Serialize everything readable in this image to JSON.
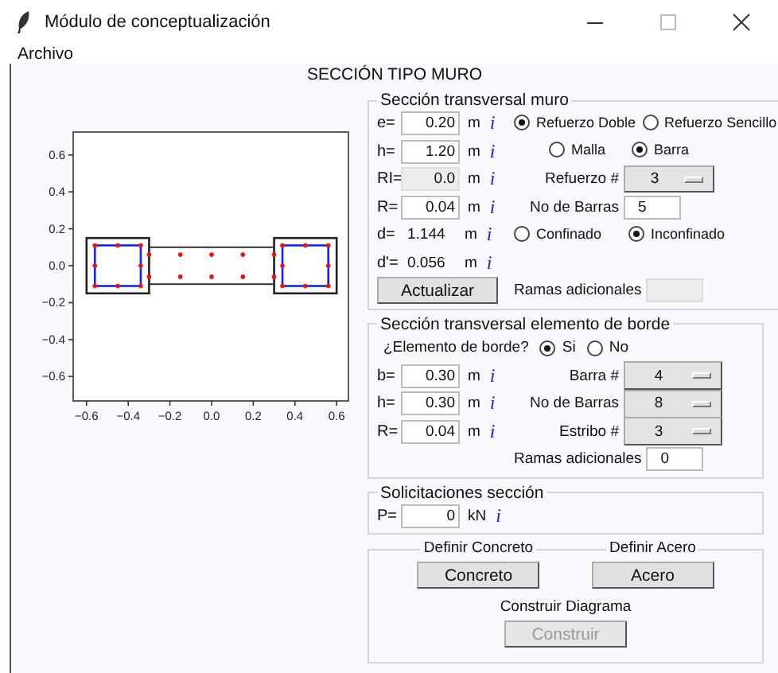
{
  "window": {
    "title": "Módulo de conceptualización"
  },
  "menu": [
    "Archivo"
  ],
  "header": "SECCIÓN TIPO MURO",
  "plot": {
    "xticks": [
      "−0.6",
      "−0.4",
      "−0.2",
      "0.0",
      "0.2",
      "0.4",
      "0.6"
    ],
    "yticks": [
      "0.6",
      "0.4",
      "0.2",
      "0.0",
      "−0.2",
      "−0.4",
      "−0.6"
    ]
  },
  "muro": {
    "legend": "Sección transversal muro",
    "params": [
      {
        "kind": "entry",
        "label": "e=",
        "value": "0.20",
        "unit": "m",
        "info": "i",
        "disabled": false
      },
      {
        "kind": "entry",
        "label": "h=",
        "value": "1.20",
        "unit": "m",
        "info": "i",
        "disabled": false
      },
      {
        "kind": "entry",
        "label": "RI=",
        "value": "0.0",
        "unit": "m",
        "info": "i",
        "disabled": true
      },
      {
        "kind": "entry",
        "label": "R=",
        "value": "0.04",
        "unit": "m",
        "info": "i",
        "disabled": false
      },
      {
        "kind": "text",
        "label": "d=",
        "value": "1.144",
        "unit": "m",
        "info": "i"
      },
      {
        "kind": "text",
        "label": "d'=",
        "value": "0.056",
        "unit": "m",
        "info": "i"
      }
    ],
    "reinforcement": [
      {
        "label": "Refuerzo Doble",
        "selected": true
      },
      {
        "label": "Refuerzo Sencillo",
        "selected": false
      }
    ],
    "layout": [
      {
        "label": "Malla",
        "selected": false
      },
      {
        "label": "Barra",
        "selected": true
      }
    ],
    "bar_size": {
      "label": "Refuerzo #",
      "value": "3"
    },
    "bar_count": {
      "label": "No de Barras",
      "value": "5"
    },
    "confinement": [
      {
        "label": "Confinado",
        "selected": false
      },
      {
        "label": "Inconfinado",
        "selected": true
      }
    ],
    "update_button": "Actualizar",
    "extra_branches": {
      "label": "Ramas adicionales",
      "disabled": true
    }
  },
  "borde": {
    "legend": "Sección transversal elemento de borde",
    "question": "¿Elemento de borde?",
    "options": [
      {
        "label": "Si",
        "selected": true
      },
      {
        "label": "No",
        "selected": false
      }
    ],
    "params": [
      {
        "kind": "entry",
        "label": "b=",
        "value": "0.30",
        "unit": "m",
        "info": "i",
        "disabled": false
      },
      {
        "kind": "entry",
        "label": "h=",
        "value": "0.30",
        "unit": "m",
        "info": "i",
        "disabled": false
      },
      {
        "kind": "entry",
        "label": "R=",
        "value": "0.04",
        "unit": "m",
        "info": "i",
        "disabled": false
      }
    ],
    "selectors": [
      {
        "label": "Barra #",
        "value": "4"
      },
      {
        "label": "No de Barras",
        "value": "8"
      },
      {
        "label": "Estribo #",
        "value": "3"
      }
    ],
    "extra_branches": {
      "label": "Ramas adicionales",
      "value": "0",
      "disabled": false
    }
  },
  "solicitaciones": {
    "legend": "Solicitaciones sección",
    "params": [
      {
        "kind": "entry",
        "label": "P=",
        "value": "0",
        "unit": "kN",
        "info": "i",
        "disabled": false
      }
    ]
  },
  "actions": {
    "groups": [
      {
        "legend": "Definir Concreto",
        "button": "Concreto",
        "disabled": false
      },
      {
        "legend": "Definir Acero",
        "button": "Acero",
        "disabled": false
      }
    ],
    "build": {
      "legend": "Construir Diagrama",
      "button": "Construir",
      "disabled": true
    }
  }
}
